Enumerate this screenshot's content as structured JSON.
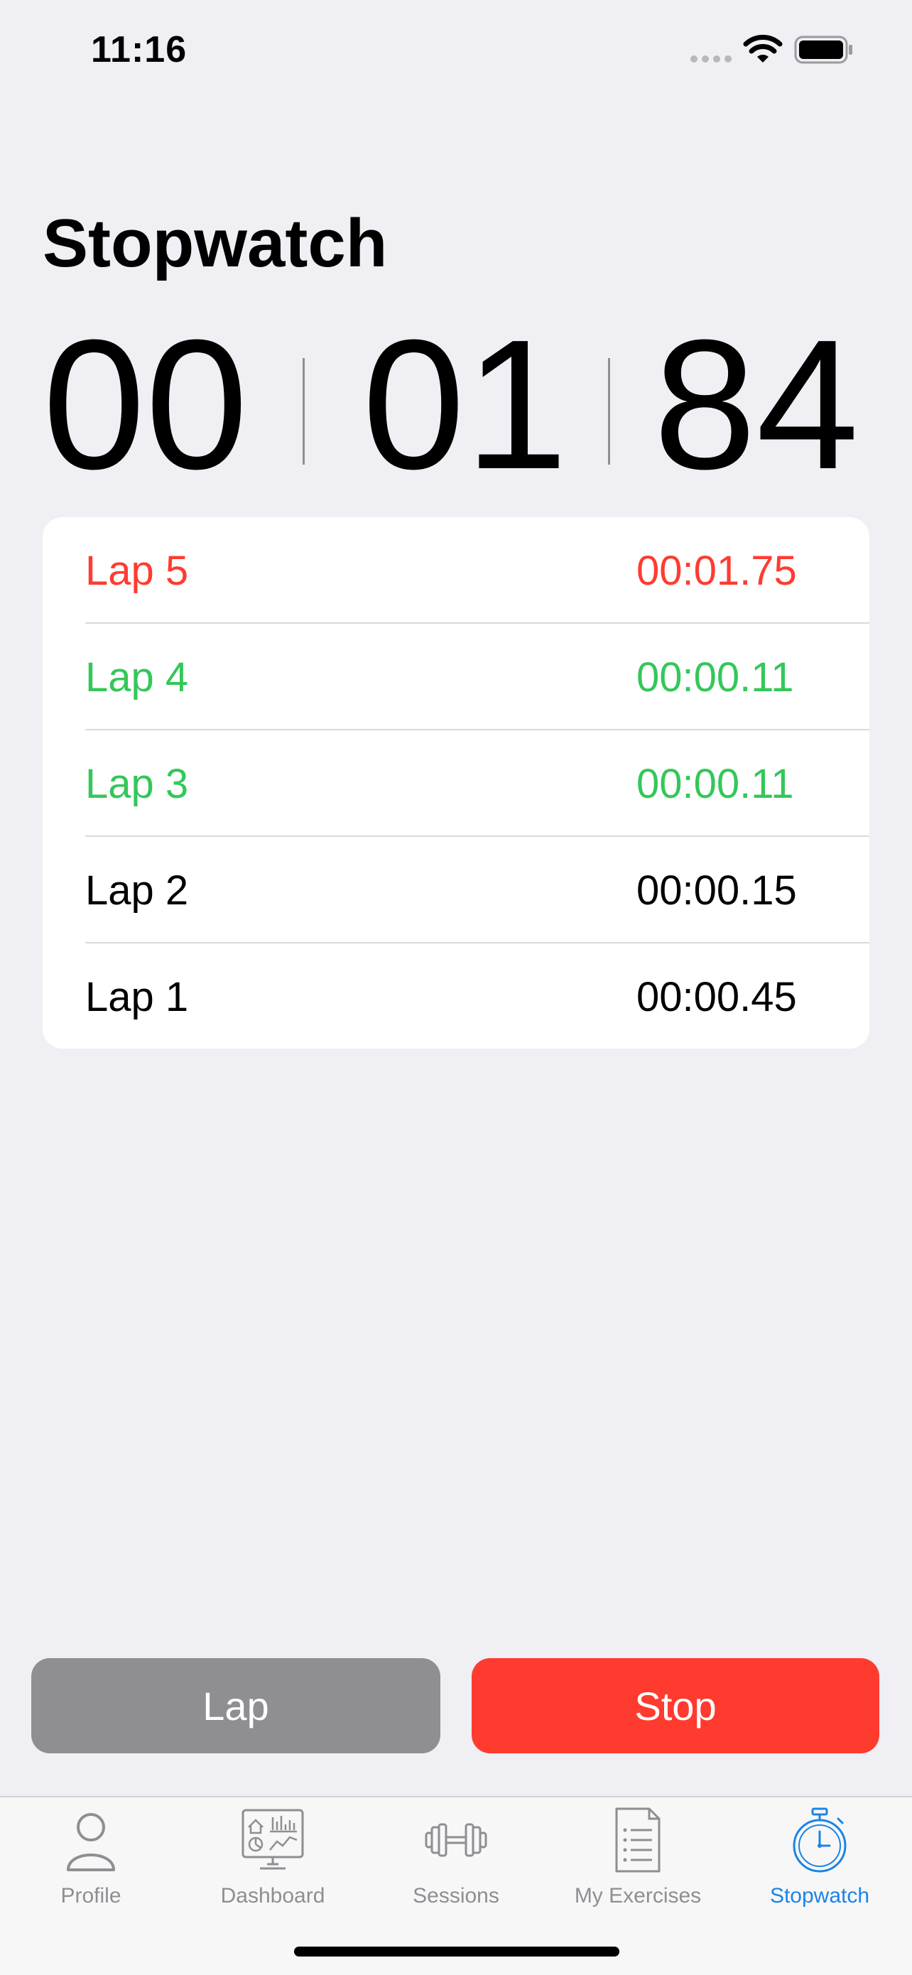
{
  "status_bar": {
    "time": "11:16"
  },
  "title": "Stopwatch",
  "time_display": {
    "minutes": "00",
    "seconds": "01",
    "centiseconds": "84"
  },
  "laps": [
    {
      "label": "Lap 5",
      "time": "00:01.75",
      "color": "#ff3b30"
    },
    {
      "label": "Lap 4",
      "time": "00:00.11",
      "color": "#34c759"
    },
    {
      "label": "Lap 3",
      "time": "00:00.11",
      "color": "#34c759"
    },
    {
      "label": "Lap 2",
      "time": "00:00.15",
      "color": "#000000"
    },
    {
      "label": "Lap 1",
      "time": "00:00.45",
      "color": "#000000"
    }
  ],
  "buttons": {
    "lap": "Lap",
    "stop": "Stop"
  },
  "tabs": [
    {
      "label": "Profile",
      "icon": "person-icon"
    },
    {
      "label": "Dashboard",
      "icon": "dashboard-icon"
    },
    {
      "label": "Sessions",
      "icon": "dumbbell-icon"
    },
    {
      "label": "My Exercises",
      "icon": "checklist-icon"
    },
    {
      "label": "Stopwatch",
      "icon": "stopwatch-icon",
      "active": true
    }
  ],
  "colors": {
    "accent": "#1a84e8",
    "stop": "#ff3b30",
    "lap_button": "#8e8e93",
    "fastest": "#34c759"
  }
}
